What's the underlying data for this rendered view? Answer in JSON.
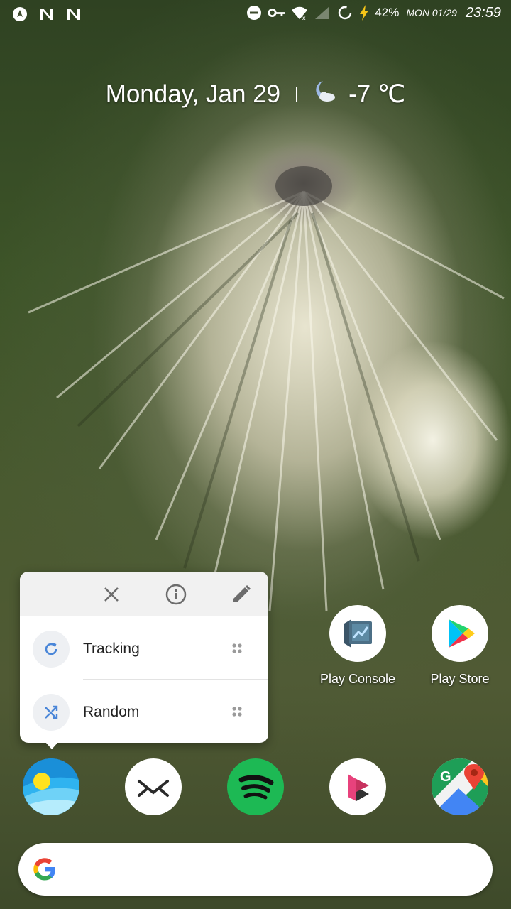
{
  "status_bar": {
    "left_icons": [
      "location-icon",
      "notification-n-icon",
      "notification-n-icon"
    ],
    "right_icons": [
      "do-not-disturb-icon",
      "vpn-key-icon",
      "wifi-icon",
      "no-signal-icon",
      "sync-circle-icon",
      "charging-icon"
    ],
    "battery": "42%",
    "date": "MON 01/29",
    "time": "23:59"
  },
  "glance": {
    "date": "Monday, Jan 29",
    "weather_icon": "moon-cloud-icon",
    "temperature": "-7 ℃"
  },
  "popup": {
    "header_actions": [
      "close-icon",
      "info-icon",
      "edit-icon"
    ],
    "shortcuts": [
      {
        "label": "Tracking",
        "icon": "refresh-icon"
      },
      {
        "label": "Random",
        "icon": "shuffle-icon"
      }
    ]
  },
  "apps": {
    "row": [
      {
        "label": "Play Console",
        "icon": "play-console-icon"
      },
      {
        "label": "Play Store",
        "icon": "play-store-icon"
      }
    ],
    "dock": [
      {
        "icon": "wallpaper-app-icon"
      },
      {
        "icon": "mail-app-icon"
      },
      {
        "icon": "spotify-icon"
      },
      {
        "icon": "pink-k-app-icon"
      },
      {
        "icon": "google-maps-icon"
      }
    ]
  },
  "search": {
    "logo": "google-g-icon"
  },
  "colors": {
    "accent_blue": "#4a86d8",
    "spotify_green": "#1db954"
  }
}
